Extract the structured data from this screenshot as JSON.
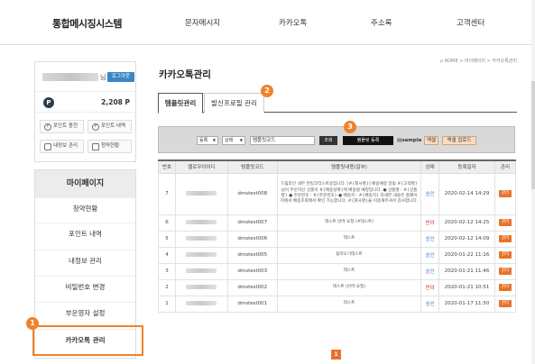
{
  "header": {
    "logo": "통합메시징시스템",
    "nav": [
      "문자메시지",
      "카카오톡",
      "주소록",
      "고객센터"
    ]
  },
  "user": {
    "name_suffix": "님",
    "logout_label": "로그아웃",
    "points": "2,208 P",
    "point_symbol": "P",
    "quick": [
      {
        "label": "포인트 충전",
        "icon": "P"
      },
      {
        "label": "포인트 내역",
        "icon": "P"
      },
      {
        "label": "내정보 관리",
        "icon": "user"
      },
      {
        "label": "청약현황",
        "icon": "doc"
      }
    ]
  },
  "sidebar": {
    "title": "마이페이지",
    "items": [
      "청약현황",
      "포인트 내역",
      "내정보 관리",
      "비밀번호 변경",
      "부운영자 설정",
      "카카오톡 관리"
    ]
  },
  "breadcrumb": "⌂  HOME > 마이페이지 > 카카오톡관리",
  "page_title": "카카오톡관리",
  "tabs": [
    "템플릿관리",
    "발신프로필 관리"
  ],
  "toolbar": {
    "select_status": "등록",
    "select_state": "상태",
    "search_value": "템플릿코드",
    "search_button": "조회",
    "register_button": "템플릿 등록",
    "sample_label": "sample",
    "excel_label": "엑셀",
    "excel_upload": "엑셀 업로드"
  },
  "badges": {
    "b1": "1",
    "b2": "2",
    "b3": "3"
  },
  "table": {
    "headers": [
      "번호",
      "옐로우아이디",
      "템플릿코드",
      "템플릿내용(일부)",
      "상태",
      "등록일자",
      "관리"
    ],
    "rows": [
      {
        "no": "7",
        "code": "dmstest008",
        "content": "드림라인 내부 컨팅크리스트용입니다. [#{회사명}] 배송예정 알림 #{고객명}님이 주문하신 상품이 #{배송날짜}에 배송될 예정입니다. ● 상품명 : #{상품명} ● 주문번호 : #{주문번호} ● 배송지 : #{배송지} 자세한 내용은 홈페이지에서 배송조회에서 확인 가능합니다. #{회사명}을 이용해주셔서 감사합니다.",
        "state": "승인",
        "date": "2020-02-14 14:29",
        "manage": "관리"
      },
      {
        "no": "6",
        "code": "dmstest007",
        "content": "테스트 반려 요청 (#테스트)",
        "state": "반려",
        "date": "2020-02-12 14:25",
        "manage": "관리"
      },
      {
        "no": "5",
        "code": "dmstest006",
        "content": "테스트",
        "state": "승인",
        "date": "2020-02-12 14:09",
        "manage": "관리"
      },
      {
        "no": "4",
        "code": "dmstest005",
        "content": "블라오기테스트",
        "state": "승인",
        "date": "2020-01-22 11:16",
        "manage": "관리"
      },
      {
        "no": "3",
        "code": "dmstest003",
        "content": "테스트",
        "state": "승인",
        "date": "2020-01-21 11:46",
        "manage": "관리"
      },
      {
        "no": "2",
        "code": "dmstest002",
        "content": "테스트 (반려 요청)",
        "state": "반려",
        "date": "2020-01-21 10:51",
        "manage": "관리"
      },
      {
        "no": "1",
        "code": "dmstest001",
        "content": "테스트",
        "state": "승인",
        "date": "2020-01-17 11:50",
        "manage": "관리"
      }
    ]
  },
  "pagination": {
    "current": "1"
  },
  "colors": {
    "accent": "#f0822c",
    "manage": "#e8722a",
    "logout": "#3b86c6",
    "approved": "#3d78c2",
    "rejected": "#d0312d"
  }
}
